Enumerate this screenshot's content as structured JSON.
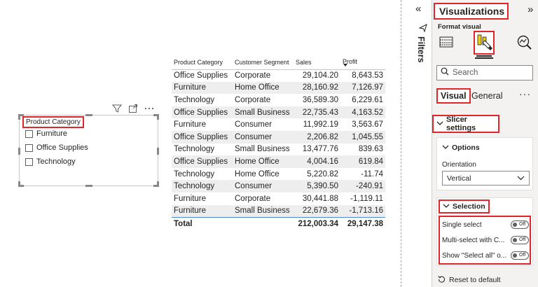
{
  "slicer": {
    "title": "Product Category",
    "items": [
      "Furniture",
      "Office Supplies",
      "Technology"
    ]
  },
  "table": {
    "columns": [
      "Product Category",
      "Customer Segment",
      "Sales",
      "Profit"
    ],
    "rows": [
      [
        "Office Supplies",
        "Corporate",
        "29,104.20",
        "8,643.53"
      ],
      [
        "Furniture",
        "Home Office",
        "28,160.92",
        "7,126.97"
      ],
      [
        "Technology",
        "Corporate",
        "36,589.30",
        "6,229.61"
      ],
      [
        "Office Supplies",
        "Small Business",
        "22,735.43",
        "4,163.52"
      ],
      [
        "Furniture",
        "Consumer",
        "11,992.19",
        "3,563.67"
      ],
      [
        "Office Supplies",
        "Consumer",
        "2,206.82",
        "1,045.55"
      ],
      [
        "Technology",
        "Small Business",
        "13,477.76",
        "839.63"
      ],
      [
        "Office Supplies",
        "Home Office",
        "4,004.16",
        "619.84"
      ],
      [
        "Technology",
        "Home Office",
        "5,220.82",
        "-11.74"
      ],
      [
        "Technology",
        "Consumer",
        "5,390.50",
        "-240.91"
      ],
      [
        "Furniture",
        "Corporate",
        "30,441.88",
        "-1,119.11"
      ],
      [
        "Furniture",
        "Small Business",
        "22,679.36",
        "-1,713.16"
      ]
    ],
    "total": {
      "label": "Total",
      "sales": "212,003.34",
      "profit": "29,147.38"
    }
  },
  "filters": {
    "label": "Filters",
    "collapse_glyph": "«"
  },
  "visualizations": {
    "title": "Visualizations",
    "expand_glyph": "»",
    "format_visual_label": "Format visual",
    "search_placeholder": "Search",
    "tabs": {
      "visual": "Visual",
      "general": "General",
      "more": "···"
    },
    "slicer_settings": "Slicer settings",
    "options": {
      "header": "Options",
      "orientation_label": "Orientation",
      "orientation_value": "Vertical"
    },
    "selection": {
      "header": "Selection",
      "items": [
        {
          "label": "Single select",
          "state": "Off"
        },
        {
          "label": "Multi-select with C...",
          "state": "Off"
        },
        {
          "label": "Show \"Select all\" o...",
          "state": "Off"
        }
      ]
    },
    "reset": "Reset to default"
  },
  "colors": {
    "highlight_border": "#e0252b",
    "pane_background": "#f3f2f1",
    "row_alt": "#eeeeee",
    "total_rule": "#4a8ec7",
    "format_icon_yellow": "#f2c811"
  },
  "icons": {
    "slicer_header": [
      "filter-icon",
      "focus-mode-icon",
      "more-options-icon"
    ],
    "pane_toolbar": [
      "build-visual-icon",
      "format-visual-icon",
      "analytics-icon"
    ]
  }
}
